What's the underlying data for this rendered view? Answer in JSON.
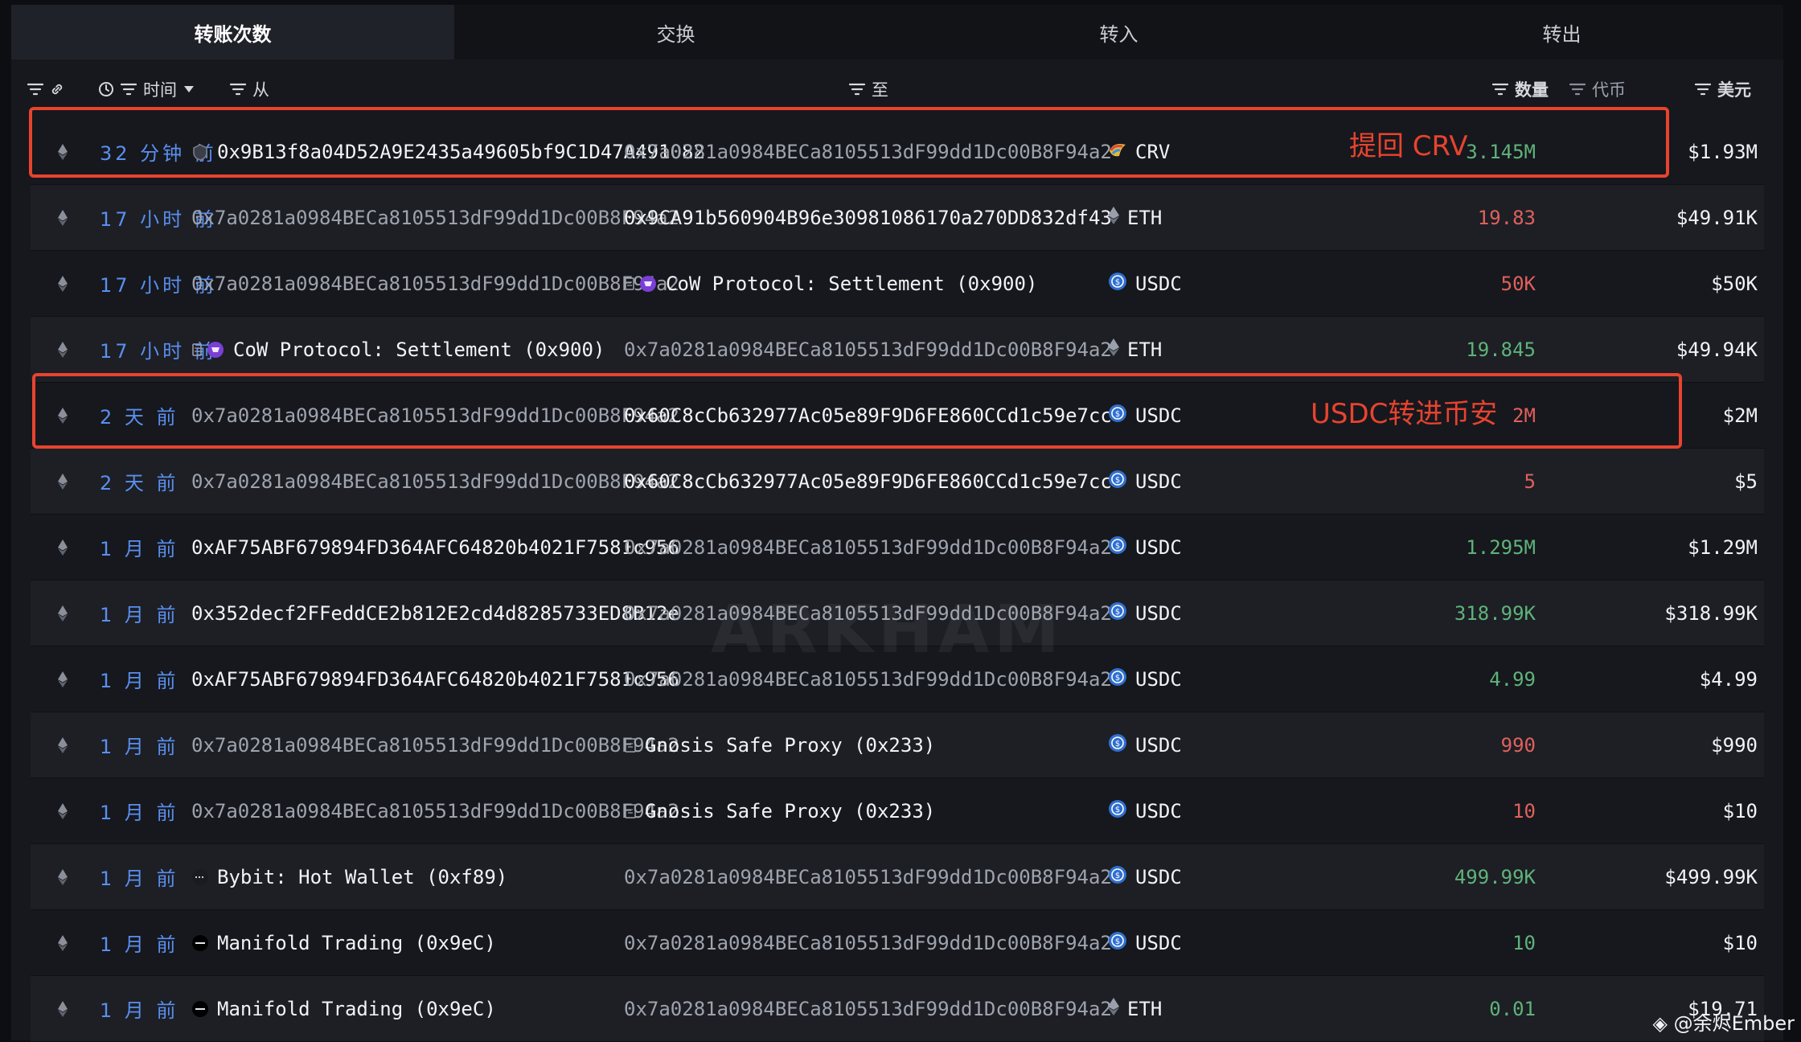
{
  "tabs": [
    {
      "label": "转账次数"
    },
    {
      "label": "交换"
    },
    {
      "label": "转入"
    },
    {
      "label": "转出"
    }
  ],
  "columns": {
    "time": "时间",
    "from": "从",
    "to": "至",
    "quantity": "数量",
    "token": "代币",
    "usd": "美元"
  },
  "rows": [
    {
      "time": "32 分钟 前",
      "from": "0x9B13f8a04D52A9E2435a49605bf9C1D47A491082",
      "from_icon": "shield-icon",
      "to": "0x7a0281a0984BECa8105513dF99dd1Dc00B8F94a2",
      "amount": "3.145M",
      "amount_color": "green",
      "token": "CRV",
      "token_icon": "crv-icon",
      "usd": "$1.93M",
      "from_bright": true,
      "to_bright": false
    },
    {
      "time": "17 小时 前",
      "from": "0x7a0281a0984BECa8105513dF99dd1Dc00B8F94a2",
      "to": "0x9CA91b560904B96e30981086170a270DD832df43",
      "amount": "19.83",
      "amount_color": "red",
      "token": "ETH",
      "token_icon": "eth-icon",
      "usd": "$49.91K",
      "from_bright": false,
      "to_bright": true
    },
    {
      "time": "17 小时 前",
      "from": "0x7a0281a0984BECa8105513dF99dd1Dc00B8F94a2",
      "to": "CoW Protocol: Settlement (0x900)",
      "to_icon": "cow-icon",
      "amount": "50K",
      "amount_color": "red",
      "token": "USDC",
      "token_icon": "usdc-icon",
      "usd": "$50K",
      "from_bright": false,
      "to_bright": true
    },
    {
      "time": "17 小时 前",
      "from": "CoW Protocol: Settlement (0x900)",
      "from_icon": "cow-icon",
      "to": "0x7a0281a0984BECa8105513dF99dd1Dc00B8F94a2",
      "amount": "19.845",
      "amount_color": "green",
      "token": "ETH",
      "token_icon": "eth-icon",
      "usd": "$49.94K",
      "from_bright": true,
      "to_bright": false
    },
    {
      "time": "2 天 前",
      "from": "0x7a0281a0984BECa8105513dF99dd1Dc00B8F94a2",
      "to": "0x60C8cCb632977Ac05e89F9D6FE860CCd1c59e7cc",
      "amount": "2M",
      "amount_color": "red",
      "token": "USDC",
      "token_icon": "usdc-icon",
      "usd": "$2M",
      "from_bright": false,
      "to_bright": true
    },
    {
      "time": "2 天 前",
      "from": "0x7a0281a0984BECa8105513dF99dd1Dc00B8F94a2",
      "to": "0x60C8cCb632977Ac05e89F9D6FE860CCd1c59e7cc",
      "amount": "5",
      "amount_color": "red",
      "token": "USDC",
      "token_icon": "usdc-icon",
      "usd": "$5",
      "from_bright": false,
      "to_bright": true
    },
    {
      "time": "1 月 前",
      "from": "0xAF75ABF679894FD364AFC64820b4021F7581c956",
      "to": "0x7a0281a0984BECa8105513dF99dd1Dc00B8F94a2",
      "amount": "1.295M",
      "amount_color": "green",
      "token": "USDC",
      "token_icon": "usdc-icon",
      "usd": "$1.29M",
      "from_bright": true,
      "to_bright": false
    },
    {
      "time": "1 月 前",
      "from": "0x352decf2FFeddCE2b812E2cd4d8285733ED8B12e",
      "to": "0x7a0281a0984BECa8105513dF99dd1Dc00B8F94a2",
      "amount": "318.99K",
      "amount_color": "green",
      "token": "USDC",
      "token_icon": "usdc-icon",
      "usd": "$318.99K",
      "from_bright": true,
      "to_bright": false
    },
    {
      "time": "1 月 前",
      "from": "0xAF75ABF679894FD364AFC64820b4021F7581c956",
      "to": "0x7a0281a0984BECa8105513dF99dd1Dc00B8F94a2",
      "amount": "4.99",
      "amount_color": "green",
      "token": "USDC",
      "token_icon": "usdc-icon",
      "usd": "$4.99",
      "from_bright": true,
      "to_bright": false
    },
    {
      "time": "1 月 前",
      "from": "0x7a0281a0984BECa8105513dF99dd1Dc00B8F94a2",
      "to": "Gnosis Safe Proxy (0x233)",
      "to_icon": "contract-icon",
      "amount": "990",
      "amount_color": "red",
      "token": "USDC",
      "token_icon": "usdc-icon",
      "usd": "$990",
      "from_bright": false,
      "to_bright": true
    },
    {
      "time": "1 月 前",
      "from": "0x7a0281a0984BECa8105513dF99dd1Dc00B8F94a2",
      "to": "Gnosis Safe Proxy (0x233)",
      "to_icon": "contract-icon",
      "amount": "10",
      "amount_color": "red",
      "token": "USDC",
      "token_icon": "usdc-icon",
      "usd": "$10",
      "from_bright": false,
      "to_bright": true
    },
    {
      "time": "1 月 前",
      "from": "Bybit: Hot Wallet (0xf89)",
      "from_icon": "bybit-icon",
      "to": "0x7a0281a0984BECa8105513dF99dd1Dc00B8F94a2",
      "amount": "499.99K",
      "amount_color": "green",
      "token": "USDC",
      "token_icon": "usdc-icon",
      "usd": "$499.99K",
      "from_bright": true,
      "to_bright": false
    },
    {
      "time": "1 月 前",
      "from": "Manifold Trading (0x9eC)",
      "from_icon": "manifold-icon",
      "to": "0x7a0281a0984BECa8105513dF99dd1Dc00B8F94a2",
      "amount": "10",
      "amount_color": "green",
      "token": "USDC",
      "token_icon": "usdc-icon",
      "usd": "$10",
      "from_bright": true,
      "to_bright": false
    },
    {
      "time": "1 月 前",
      "from": "Manifold Trading (0x9eC)",
      "from_icon": "manifold-icon",
      "to": "0x7a0281a0984BECa8105513dF99dd1Dc00B8F94a2",
      "amount": "0.01",
      "amount_color": "green",
      "token": "ETH",
      "token_icon": "eth-icon",
      "usd": "$19.71",
      "from_bright": true,
      "to_bright": false
    }
  ],
  "annotations": {
    "row1_note": "提回 CRV",
    "row5_note": "USDC转进币安"
  },
  "watermark": "ARKHAM",
  "credit": "@余烬Ember",
  "colors": {
    "annotation": "#e8432f",
    "link_time": "#5a8ff0",
    "inflow": "#5fb37a",
    "outflow": "#e0605c"
  }
}
